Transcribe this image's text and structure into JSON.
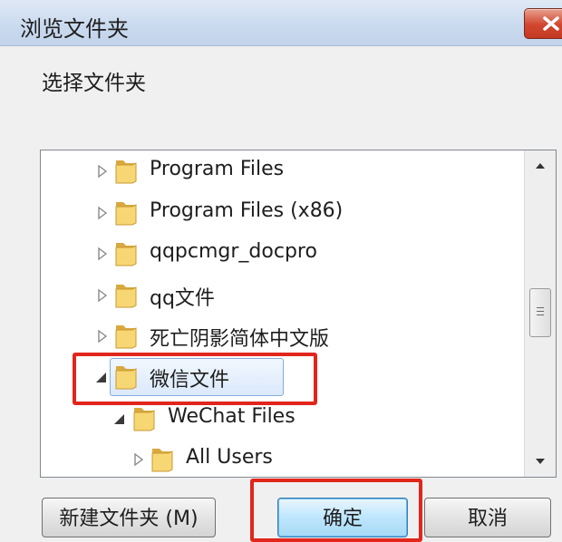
{
  "window": {
    "title": "浏览文件夹",
    "prompt": "选择文件夹"
  },
  "tree": {
    "items": [
      {
        "label": "Program Files",
        "level": 1,
        "expanded": false,
        "selected": false
      },
      {
        "label": "Program Files (x86)",
        "level": 1,
        "expanded": false,
        "selected": false
      },
      {
        "label": "qqpcmgr_docpro",
        "level": 1,
        "expanded": false,
        "selected": false
      },
      {
        "label": "qq文件",
        "level": 1,
        "expanded": false,
        "selected": false
      },
      {
        "label": "死亡阴影简体中文版",
        "level": 1,
        "expanded": false,
        "selected": false
      },
      {
        "label": "微信文件",
        "level": 1,
        "expanded": true,
        "selected": true
      },
      {
        "label": "WeChat Files",
        "level": 2,
        "expanded": true,
        "selected": false
      },
      {
        "label": "All Users",
        "level": 3,
        "expanded": false,
        "selected": false
      }
    ]
  },
  "buttons": {
    "new_folder": "新建文件夹 (M)",
    "ok": "确定",
    "cancel": "取消"
  },
  "colors": {
    "annotation": "#e1261c",
    "selection": "#dbe9fb",
    "close": "#c23a22"
  }
}
